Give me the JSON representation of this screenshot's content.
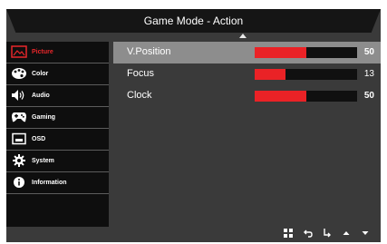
{
  "title": "Game Mode - Action",
  "sidebar": {
    "items": [
      {
        "label": "Picture",
        "icon": "picture-icon",
        "active": true
      },
      {
        "label": "Color",
        "icon": "palette-icon",
        "active": false
      },
      {
        "label": "Audio",
        "icon": "speaker-icon",
        "active": false
      },
      {
        "label": "Gaming",
        "icon": "gamepad-icon",
        "active": false
      },
      {
        "label": "OSD",
        "icon": "osd-icon",
        "active": false
      },
      {
        "label": "System",
        "icon": "gear-icon",
        "active": false
      },
      {
        "label": "Information",
        "icon": "info-icon",
        "active": false
      }
    ]
  },
  "settings": [
    {
      "label": "V.Position",
      "value": "50",
      "level": 0.5,
      "selected": true
    },
    {
      "label": "Focus",
      "value": "13",
      "level": 0.3,
      "selected": false
    },
    {
      "label": "Clock",
      "value": "50",
      "level": 0.5,
      "selected": false
    }
  ],
  "bottom_bar": {
    "buttons": [
      "menu-grid-icon",
      "back-icon",
      "enter-icon",
      "up-arrow-icon",
      "down-arrow-icon"
    ]
  },
  "colors": {
    "accent": "#ea2226",
    "title_bg": "#151515",
    "panel_bg": "#3a3a3a",
    "sidebar_bg": "#0e0e0e",
    "selected_row": "#8d8d8d"
  }
}
